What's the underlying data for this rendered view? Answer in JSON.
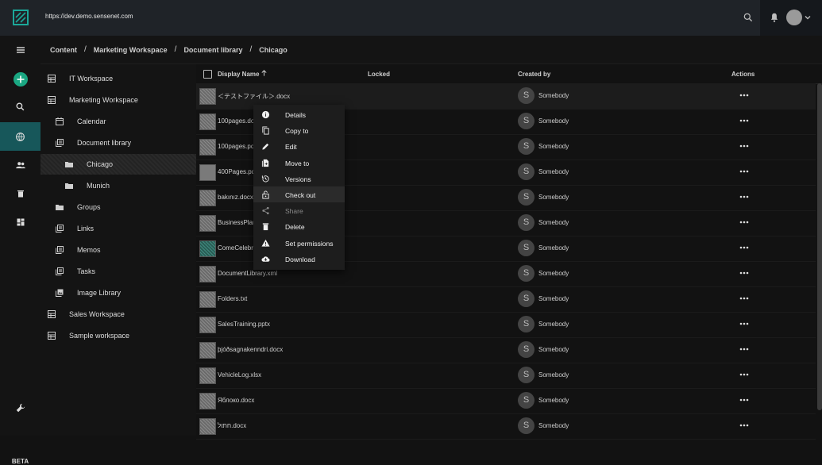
{
  "header": {
    "url": "https://dev.demo.sensenet.com"
  },
  "rail": {
    "beta_label": "BETA"
  },
  "breadcrumb": [
    "Content",
    "Marketing Workspace",
    "Document library",
    "Chicago"
  ],
  "tree": [
    {
      "label": "IT Workspace",
      "icon": "workspace-icon"
    },
    {
      "label": "Marketing Workspace",
      "icon": "workspace-icon"
    },
    {
      "label": "Calendar",
      "icon": "calendar-icon"
    },
    {
      "label": "Document library",
      "icon": "library-icon"
    },
    {
      "label": "Chicago",
      "icon": "folder-icon"
    },
    {
      "label": "Munich",
      "icon": "folder-icon"
    },
    {
      "label": "Groups",
      "icon": "folder-icon"
    },
    {
      "label": "Links",
      "icon": "library-icon"
    },
    {
      "label": "Memos",
      "icon": "library-icon"
    },
    {
      "label": "Tasks",
      "icon": "library-icon"
    },
    {
      "label": "Image Library",
      "icon": "image-library-icon"
    },
    {
      "label": "Sales Workspace",
      "icon": "workspace-icon"
    },
    {
      "label": "Sample workspace",
      "icon": "workspace-icon"
    }
  ],
  "list": {
    "columns": {
      "name": "Display Name",
      "locked": "Locked",
      "created_by": "Created by",
      "actions": "Actions"
    },
    "rows": [
      {
        "name": "＜テストファイル＞.docx",
        "creator": "Somebody",
        "creator_initial": "S"
      },
      {
        "name": "100pages.docx",
        "creator": "Somebody",
        "creator_initial": "S"
      },
      {
        "name": "100pages.pdf",
        "creator": "Somebody",
        "creator_initial": "S"
      },
      {
        "name": "400Pages.pdf",
        "creator": "Somebody",
        "creator_initial": "S"
      },
      {
        "name": "bakınız.docx",
        "creator": "Somebody",
        "creator_initial": "S"
      },
      {
        "name": "BusinessPlan.docx",
        "creator": "Somebody",
        "creator_initial": "S"
      },
      {
        "name": "ComeCelebrate.jpg",
        "creator": "Somebody",
        "creator_initial": "S"
      },
      {
        "name": "DocumentLibrary.xml",
        "creator": "Somebody",
        "creator_initial": "S"
      },
      {
        "name": "Folders.txt",
        "creator": "Somebody",
        "creator_initial": "S"
      },
      {
        "name": "SalesTraining.pptx",
        "creator": "Somebody",
        "creator_initial": "S"
      },
      {
        "name": "þjóðsagnakenndri.docx",
        "creator": "Somebody",
        "creator_initial": "S"
      },
      {
        "name": "VehicleLog.xlsx",
        "creator": "Somebody",
        "creator_initial": "S"
      },
      {
        "name": "Яблоко.docx",
        "creator": "Somebody",
        "creator_initial": "S"
      },
      {
        "name": "חתול.docx",
        "creator": "Somebody",
        "creator_initial": "S"
      }
    ]
  },
  "context_menu": [
    {
      "label": "Details",
      "icon": "info-icon"
    },
    {
      "label": "Copy to",
      "icon": "copy-icon"
    },
    {
      "label": "Edit",
      "icon": "pencil-icon"
    },
    {
      "label": "Move to",
      "icon": "move-icon"
    },
    {
      "label": "Versions",
      "icon": "history-icon"
    },
    {
      "label": "Check out",
      "icon": "lock-open-icon"
    },
    {
      "label": "Share",
      "icon": "share-icon"
    },
    {
      "label": "Delete",
      "icon": "trash-icon"
    },
    {
      "label": "Set permissions",
      "icon": "warning-icon"
    },
    {
      "label": "Download",
      "icon": "cloud-download-icon"
    }
  ],
  "colors": {
    "accent": "#17575a",
    "add_button": "#1aa782"
  }
}
